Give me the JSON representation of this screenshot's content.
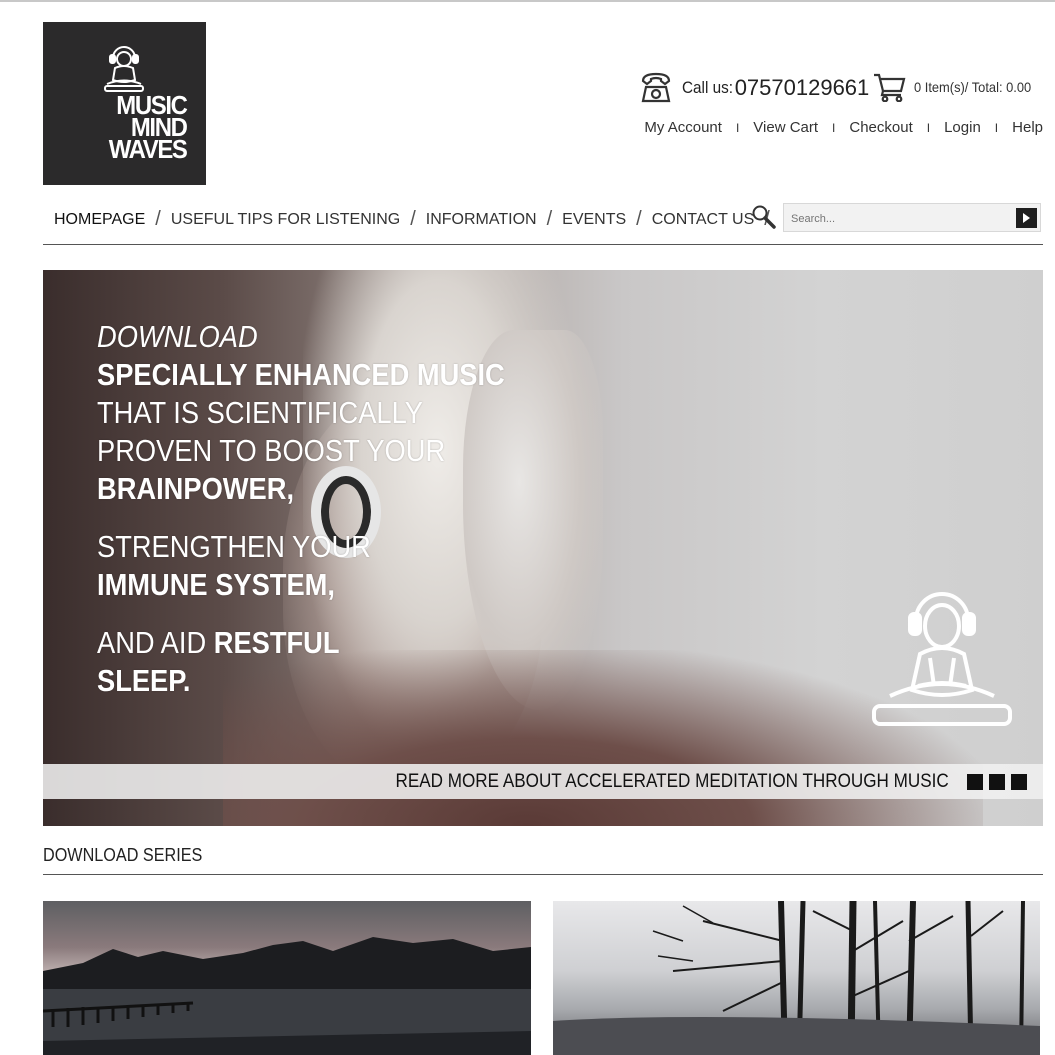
{
  "brand": {
    "logo_lines": [
      "MUSIC",
      "MIND",
      "WAVES"
    ]
  },
  "header": {
    "call_label": "Call us:",
    "phone": "07570129661",
    "cart_summary": "0 Item(s)/ Total: 0.00",
    "account_links": [
      {
        "label": "My Account"
      },
      {
        "label": "View Cart"
      },
      {
        "label": "Checkout"
      },
      {
        "label": "Login"
      },
      {
        "label": "Help"
      }
    ],
    "separator": "I"
  },
  "nav": {
    "items": [
      {
        "label": "HOMEPAGE"
      },
      {
        "label": "USEFUL TIPS FOR LISTENING"
      },
      {
        "label": "INFORMATION"
      },
      {
        "label": "EVENTS"
      },
      {
        "label": "CONTACT US"
      }
    ],
    "divider": "/",
    "search_placeholder": "Search..."
  },
  "banner": {
    "lines": [
      {
        "plain": "",
        "bold": "",
        "italic": "DOWNLOAD"
      },
      {
        "plain": "",
        "bold": "SPECIALLY ENHANCED MUSIC"
      },
      {
        "plain": "THAT IS SCIENTIFICALLY",
        "bold": ""
      },
      {
        "plain": "PROVEN TO BOOST YOUR",
        "bold": ""
      },
      {
        "plain": "",
        "bold": "BRAINPOWER,"
      },
      {
        "plain": "STRENGTHEN YOUR",
        "bold": ""
      },
      {
        "plain": "",
        "bold": "IMMUNE SYSTEM,"
      },
      {
        "plain": "AND AID ",
        "bold": "RESTFUL"
      },
      {
        "plain": "",
        "bold": "SLEEP."
      }
    ],
    "read_more": "READ MORE ABOUT ACCELERATED MEDITATION THROUGH MUSIC",
    "slide_count": 3
  },
  "series": {
    "title": "DOWNLOAD SERIES"
  },
  "colors": {
    "logo_bg": "#2b2a2b",
    "text": "#222222",
    "slider_dot": "#111111"
  }
}
